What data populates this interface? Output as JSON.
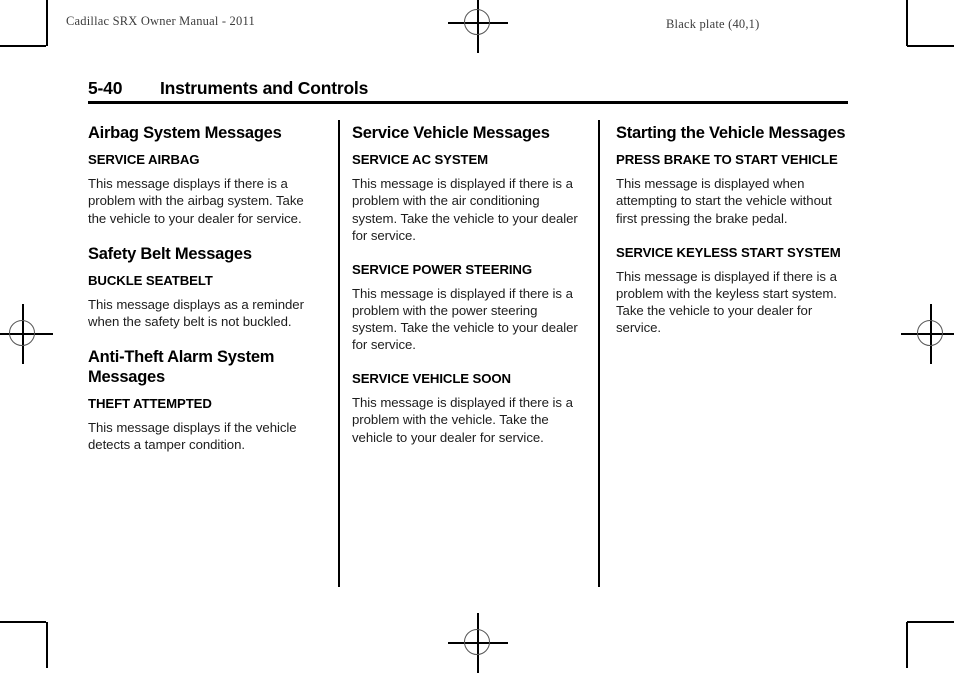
{
  "running_head": {
    "left": "Cadillac SRX Owner Manual - 2011",
    "right": "Black plate (40,1)"
  },
  "page_header": {
    "page_number": "5-40",
    "title": "Instruments and Controls"
  },
  "columns": [
    {
      "sections": [
        {
          "heading": "Airbag System Messages",
          "blocks": [
            {
              "subheading": "SERVICE AIRBAG",
              "text": "This message displays if there is a problem with the airbag system. Take the vehicle to your dealer for service."
            }
          ]
        },
        {
          "heading": "Safety Belt Messages",
          "blocks": [
            {
              "subheading": "BUCKLE SEATBELT",
              "text": "This message displays as a reminder when the safety belt is not buckled."
            }
          ]
        },
        {
          "heading": "Anti-Theft Alarm System Messages",
          "blocks": [
            {
              "subheading": "THEFT ATTEMPTED",
              "text": "This message displays if the vehicle detects a tamper condition."
            }
          ]
        }
      ]
    },
    {
      "sections": [
        {
          "heading": "Service Vehicle Messages",
          "blocks": [
            {
              "subheading": "SERVICE AC SYSTEM",
              "text": "This message is displayed if there is a problem with the air conditioning system. Take the vehicle to your dealer for service."
            },
            {
              "subheading": "SERVICE POWER STEERING",
              "text": "This message is displayed if there is a problem with the power steering system. Take the vehicle to your dealer for service."
            },
            {
              "subheading": "SERVICE VEHICLE SOON",
              "text": "This message is displayed if there is a problem with the vehicle. Take the vehicle to your dealer for service."
            }
          ]
        }
      ]
    },
    {
      "sections": [
        {
          "heading": "Starting the Vehicle Messages",
          "blocks": [
            {
              "subheading": "PRESS BRAKE TO START VEHICLE",
              "text": "This message is displayed when attempting to start the vehicle without first pressing the brake pedal."
            },
            {
              "subheading": "SERVICE KEYLESS START SYSTEM",
              "text": "This message is displayed if there is a problem with the keyless start system. Take the vehicle to your dealer for service."
            }
          ]
        }
      ]
    }
  ]
}
